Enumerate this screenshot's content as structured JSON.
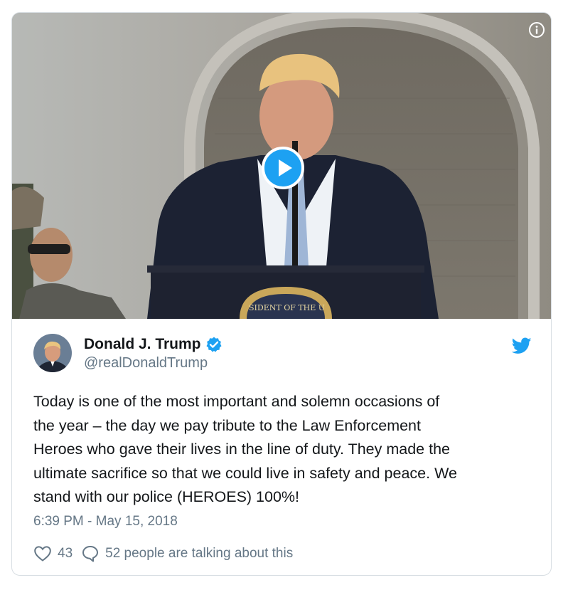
{
  "tweet": {
    "author_name": "Donald J. Trump",
    "handle": "@realDonaldTrump",
    "text": "Today is one of the most important and solemn occasions of\nthe year – the day we pay tribute to the Law Enforcement\nHeroes who gave their lives in the line of duty. They made the\nultimate sacrifice so that we could live in safety and peace. We\nstand with our police (HEROES) 100%!",
    "timestamp": "6:39 PM - May 15, 2018",
    "like_count": "43",
    "talking_text": "52 people are talking about this"
  },
  "media": {
    "podium_seal_text": "SIDENT OF THE U"
  },
  "icons": {
    "info": "info-icon",
    "play": "play-icon",
    "verified": "verified-badge-icon",
    "twitter": "twitter-bird-icon",
    "like": "heart-icon",
    "reply": "speech-bubble-icon"
  },
  "colors": {
    "accent": "#1da1f2",
    "secondary_text": "#657786",
    "primary_text": "#14171a",
    "border": "#d8dee3"
  }
}
